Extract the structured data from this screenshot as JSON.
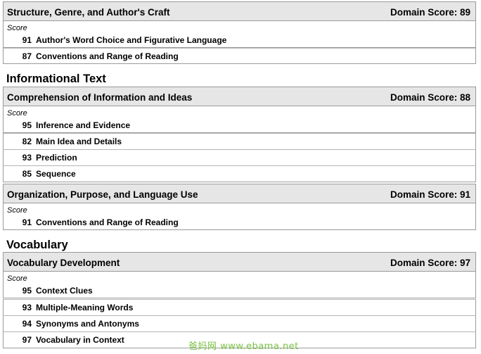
{
  "groups": [
    {
      "domain_title": "Structure, Genre, and Author's Craft",
      "domain_score": "Domain Score: 89",
      "score_label": "Score",
      "items": [
        {
          "score": "91",
          "label": "Author's Word Choice and Figurative Language"
        },
        {
          "score": "87",
          "label": "Conventions and Range of Reading"
        }
      ]
    }
  ],
  "sections": [
    {
      "title": "Informational Text",
      "groups": [
        {
          "domain_title": "Comprehension of Information and Ideas",
          "domain_score": "Domain Score: 88",
          "score_label": "Score",
          "items": [
            {
              "score": "95",
              "label": "Inference and Evidence"
            },
            {
              "score": "82",
              "label": "Main Idea and Details"
            },
            {
              "score": "93",
              "label": "Prediction"
            },
            {
              "score": "85",
              "label": "Sequence"
            }
          ]
        },
        {
          "domain_title": "Organization, Purpose, and Language Use",
          "domain_score": "Domain Score: 91",
          "score_label": "Score",
          "items": [
            {
              "score": "91",
              "label": "Conventions and Range of Reading"
            }
          ]
        }
      ]
    },
    {
      "title": "Vocabulary",
      "groups": [
        {
          "domain_title": "Vocabulary Development",
          "domain_score": "Domain Score: 97",
          "score_label": "Score",
          "items": [
            {
              "score": "95",
              "label": "Context Clues"
            },
            {
              "score": "93",
              "label": "Multiple-Meaning Words"
            },
            {
              "score": "94",
              "label": "Synonyms and Antonyms"
            },
            {
              "score": "97",
              "label": "Vocabulary in Context"
            }
          ]
        }
      ]
    }
  ],
  "watermark": "爸妈网 www.ebama.net"
}
